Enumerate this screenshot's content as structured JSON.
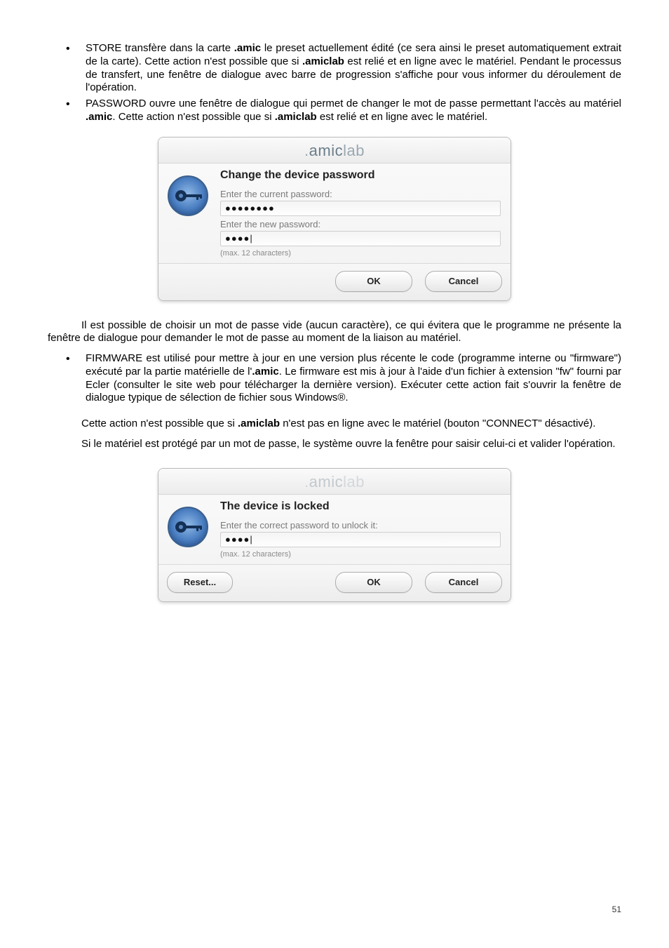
{
  "bullets_top": [
    {
      "pre": "STORE transfère dans la carte ",
      "b1": ".amic",
      "mid": " le preset actuellement édité (ce sera ainsi le preset automatiquement extrait de la carte). Cette action n'est possible que si ",
      "b2": ".amiclab",
      "tail": " est relié et en ligne avec le matériel. Pendant le processus de transfert, une fenêtre de dialogue avec barre de progression s'affiche pour vous informer du déroulement de l'opération."
    },
    {
      "pre": "PASSWORD ouvre une fenêtre de dialogue qui permet de changer le mot de passe permettant l'accès au matériel ",
      "b1": ".amic",
      "mid": ". Cette action n'est possible que si ",
      "b2": ".amiclab",
      "tail": " est relié et en ligne avec le matériel."
    }
  ],
  "brand": {
    "dot": ".",
    "p1": "amic",
    "p2": "lab"
  },
  "dialog1": {
    "heading": "Change the device password",
    "label_current": "Enter the current password:",
    "value_current": "●●●●●●●●",
    "label_new": "Enter the new password:",
    "value_new": "●●●●|",
    "hint": "(max. 12 characters)",
    "ok": "OK",
    "cancel": "Cancel"
  },
  "para_mid": "Il est possible de choisir un mot de passe vide (aucun caractère), ce qui évitera que le programme ne présente la fenêtre de dialogue pour demander le mot de passe au moment de la liaison au matériel.",
  "bullet_firmware": {
    "pre": "FIRMWARE est utilisé pour mettre à jour en une version plus récente le code (programme interne ou \"firmware\") exécuté par la partie matérielle de l'",
    "b1": ".amic",
    "tail": ". Le firmware est mis à jour à l'aide d'un fichier à extension \"fw\" fourni par Ecler (consulter le site web pour télécharger la dernière version). Exécuter cette action fait s'ouvrir la fenêtre de dialogue typique de sélection de fichier sous Windows®."
  },
  "para_after_fw_1": {
    "pre": "Cette action n'est possible que si ",
    "b1": ".amiclab",
    "tail": " n'est pas en ligne avec le matériel (bouton \"CONNECT\" désactivé)."
  },
  "para_after_fw_2": "Si le matériel est protégé par un mot de passe, le système ouvre la fenêtre pour saisir celui-ci et valider l'opération.",
  "dialog2": {
    "heading": "The device is locked",
    "label": "Enter the correct password to unlock it:",
    "value": "●●●●|",
    "hint": "(max. 12 characters)",
    "reset": "Reset...",
    "ok": "OK",
    "cancel": "Cancel"
  },
  "page_number": "51"
}
